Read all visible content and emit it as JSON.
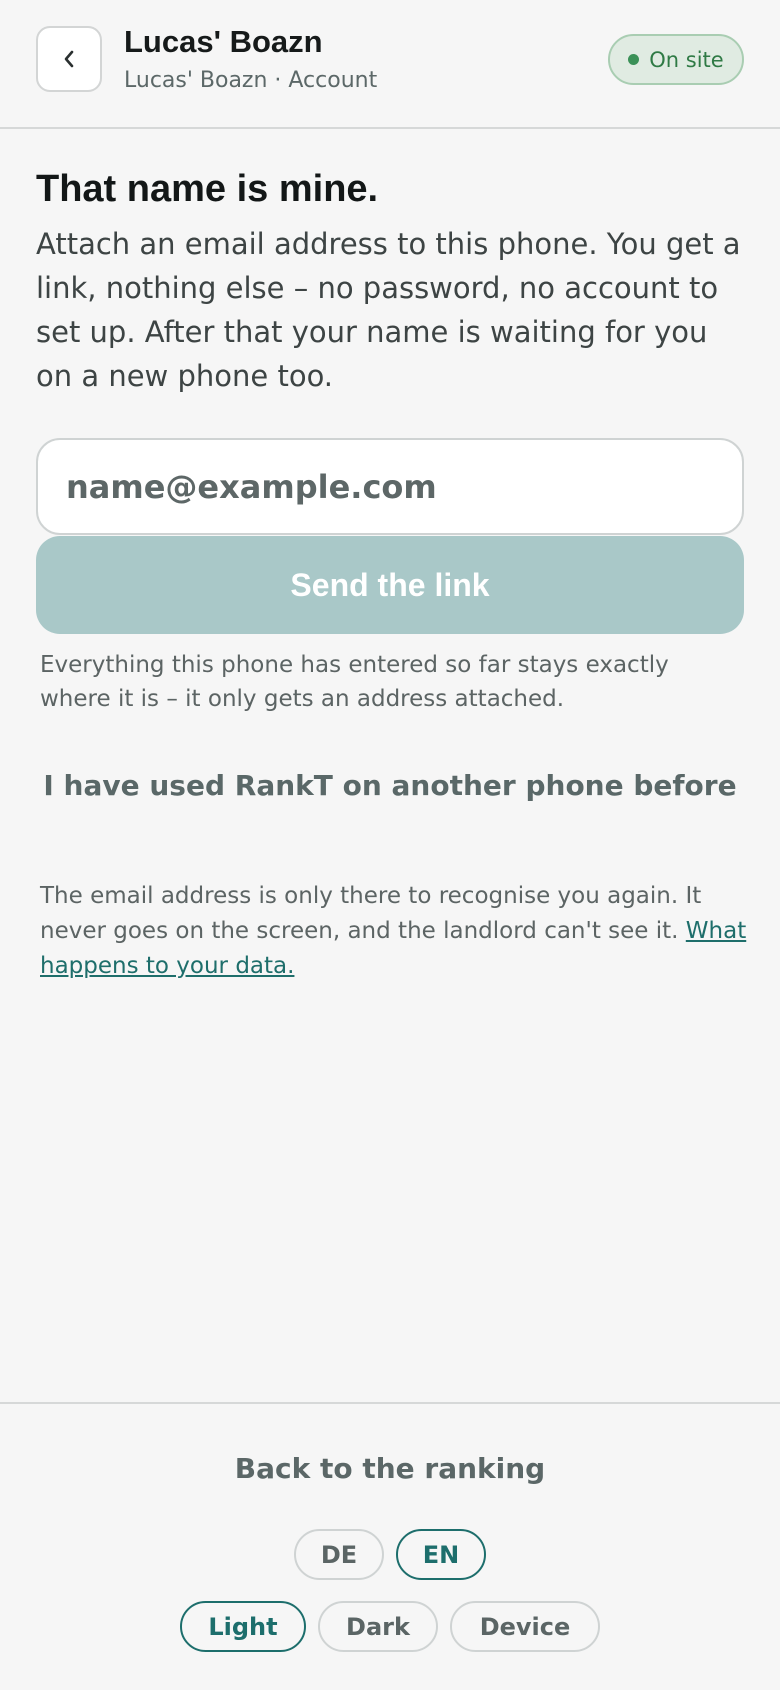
{
  "header": {
    "back_icon": "chevron-left-icon",
    "title": "Lucas' Boazn",
    "subtitle": "Lucas' Boazn · Account",
    "status_label": "On site",
    "status_color": "#3b9158"
  },
  "main": {
    "heading": "That name is mine.",
    "intro": "Attach an email address to this phone. You get a link, nothing else – no password, no account to set up. After that your name is waiting for you on a new phone too.",
    "email_placeholder": "name@example.com",
    "email_value": "",
    "send_label": "Send the link",
    "send_color": "#a9c8c8",
    "note": "Everything this phone has entered so far stays exactly where it is – it only gets an address attached.",
    "other_phone_label": "I have used RankT on another phone before",
    "privacy_text": "The email address is only there to recognise you again. It never goes on the screen, and the landlord can't see it.",
    "privacy_link": "What happens to your data."
  },
  "footer": {
    "back_label": "Back to the ranking",
    "languages": [
      {
        "label": "DE",
        "selected": false
      },
      {
        "label": "EN",
        "selected": true
      }
    ],
    "themes": [
      {
        "label": "Light",
        "selected": true
      },
      {
        "label": "Dark",
        "selected": false
      },
      {
        "label": "Device",
        "selected": false
      }
    ],
    "accent_color": "#1d6e6c"
  }
}
